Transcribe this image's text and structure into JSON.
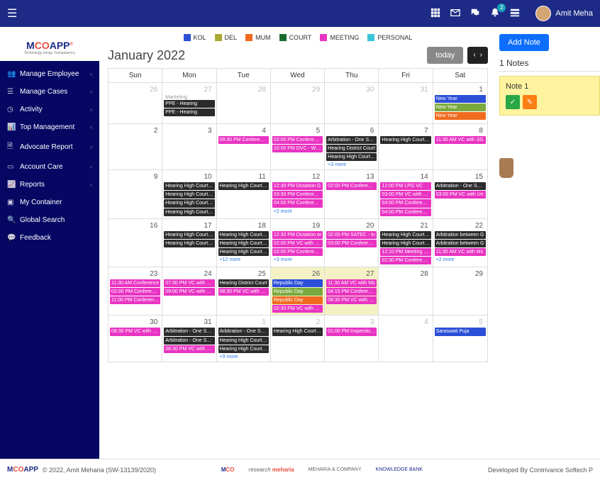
{
  "topbar": {
    "notif_count": "2",
    "user_name": "Amit Meha"
  },
  "brand": {
    "name": "MCOAPP",
    "tagline": "Technology brings Transparency"
  },
  "nav": [
    {
      "icon": "users",
      "label": "Manage Employee",
      "exp": true
    },
    {
      "icon": "list",
      "label": "Manage Cases",
      "exp": true
    },
    {
      "icon": "clock",
      "label": "Activity",
      "exp": true
    },
    {
      "icon": "chart",
      "label": "Top Management",
      "exp": true
    },
    {
      "icon": "file",
      "label": "Advocate Report",
      "exp": true
    },
    {
      "icon": "card",
      "label": "Account Care",
      "exp": true
    },
    {
      "icon": "bars",
      "label": "Reports",
      "exp": true
    },
    {
      "icon": "box",
      "label": "My Container",
      "exp": false
    },
    {
      "icon": "search",
      "label": "Global Search",
      "exp": false
    },
    {
      "icon": "chat",
      "label": "Feedback",
      "exp": false
    }
  ],
  "legend": [
    {
      "label": "KOL",
      "color": "#2c4fd8"
    },
    {
      "label": "DEL",
      "color": "#a8a833"
    },
    {
      "label": "MUM",
      "color": "#f06a1f"
    },
    {
      "label": "COURT",
      "color": "#1a6b2e"
    },
    {
      "label": "MEETING",
      "color": "#e934c3"
    },
    {
      "label": "PERSONAL",
      "color": "#3dc4d8"
    }
  ],
  "calendar": {
    "title": "January 2022",
    "today_label": "today",
    "day_names": [
      "Sun",
      "Mon",
      "Tue",
      "Wed",
      "Thu",
      "Fri",
      "Sat"
    ],
    "weeks": [
      [
        {
          "d": "26",
          "muted": true
        },
        {
          "d": "27",
          "muted": true,
          "allday": "Marketing",
          "events": [
            {
              "t": "PPE - Hearing",
              "c": "dark"
            },
            {
              "t": "PPE - Hearing",
              "c": "dark"
            }
          ]
        },
        {
          "d": "28",
          "muted": true
        },
        {
          "d": "29",
          "muted": true
        },
        {
          "d": "30",
          "muted": true
        },
        {
          "d": "31",
          "muted": true
        },
        {
          "d": "1",
          "events": [
            {
              "t": "New Year",
              "c": "blue"
            },
            {
              "t": "New Year",
              "c": "green"
            },
            {
              "t": "New Year",
              "c": "orange"
            }
          ]
        }
      ],
      [
        {
          "d": "2"
        },
        {
          "d": "3"
        },
        {
          "d": "4",
          "events": [
            {
              "t": "09:30 PM Conference",
              "c": "pink"
            }
          ]
        },
        {
          "d": "5",
          "events": [
            {
              "t": "02:00 PM Conference",
              "c": "pink"
            },
            {
              "t": "10:00 PM DVC - WBE",
              "c": "pink"
            }
          ]
        },
        {
          "d": "6",
          "events": [
            {
              "t": "Arbitration - One Sess",
              "c": "dark"
            },
            {
              "t": "Hearing District Court",
              "c": "dark"
            },
            {
              "t": "Hearing High Court/Tr",
              "c": "dark"
            }
          ],
          "more": "+3 more"
        },
        {
          "d": "7",
          "events": [
            {
              "t": "Hearing High Court/Tr",
              "c": "dark"
            }
          ]
        },
        {
          "d": "8",
          "events": [
            {
              "t": "11:30 AM VC with SG",
              "c": "pink"
            }
          ]
        }
      ],
      [
        {
          "d": "9"
        },
        {
          "d": "10",
          "events": [
            {
              "t": "Hearing High Court/Tr",
              "c": "dark"
            },
            {
              "t": "Hearing High Court/Tr",
              "c": "dark"
            },
            {
              "t": "Hearing High Court/Tr",
              "c": "dark"
            },
            {
              "t": "Hearing High Court/Tr",
              "c": "dark"
            }
          ]
        },
        {
          "d": "11",
          "events": [
            {
              "t": "Hearing High Court/Tr",
              "c": "dark"
            }
          ]
        },
        {
          "d": "12",
          "events": [
            {
              "t": "12:30 PM Dictation G",
              "c": "pink"
            },
            {
              "t": "03:30 PM Conference",
              "c": "pink"
            },
            {
              "t": "04:00 PM Conference",
              "c": "pink"
            }
          ],
          "more": "+2 more"
        },
        {
          "d": "13",
          "events": [
            {
              "t": "02:00 PM Conference",
              "c": "pink"
            }
          ]
        },
        {
          "d": "14",
          "events": [
            {
              "t": "12:00 PM LPG VC",
              "c": "pink"
            },
            {
              "t": "03:00 PM VC with Urr",
              "c": "pink"
            },
            {
              "t": "04:00 PM Conference",
              "c": "pink"
            },
            {
              "t": "04:00 PM Conference",
              "c": "pink"
            }
          ]
        },
        {
          "d": "15",
          "events": [
            {
              "t": "Arbitration - One Sess",
              "c": "dark"
            },
            {
              "t": "03:00 PM VC with Urr",
              "c": "pink"
            }
          ]
        }
      ],
      [
        {
          "d": "16"
        },
        {
          "d": "17",
          "events": [
            {
              "t": "Hearing High Court/Tr",
              "c": "dark"
            },
            {
              "t": "Hearing High Court/Tr",
              "c": "dark"
            }
          ]
        },
        {
          "d": "18",
          "events": [
            {
              "t": "Hearing High Court/Tr",
              "c": "dark"
            },
            {
              "t": "Hearing High Court/Tr",
              "c": "dark"
            },
            {
              "t": "Hearing High Court/Tr",
              "c": "dark"
            }
          ],
          "more": "+12 more"
        },
        {
          "d": "19",
          "events": [
            {
              "t": "12:30 PM Dictation or",
              "c": "pink"
            },
            {
              "t": "02:00 PM VC with Vin",
              "c": "pink"
            },
            {
              "t": "02:00 PM Conference",
              "c": "pink"
            }
          ],
          "more": "+3 more"
        },
        {
          "d": "20",
          "events": [
            {
              "t": "02:00 PM SATEC - In",
              "c": "pink"
            },
            {
              "t": "03:00 PM Conference",
              "c": "pink"
            }
          ]
        },
        {
          "d": "21",
          "events": [
            {
              "t": "Hearing High Court/Tr",
              "c": "dark"
            },
            {
              "t": "Hearing High Court/Tr",
              "c": "dark"
            },
            {
              "t": "12:10 PM Meeting Sh",
              "c": "pink"
            },
            {
              "t": "02:30 PM Conference",
              "c": "pink"
            }
          ]
        },
        {
          "d": "22",
          "events": [
            {
              "t": "Arbitration between G",
              "c": "dark"
            },
            {
              "t": "Arbitration between G",
              "c": "dark"
            },
            {
              "t": "11:30 AM VC with Ms",
              "c": "pink"
            }
          ],
          "more": "+2 more"
        }
      ],
      [
        {
          "d": "23",
          "events": [
            {
              "t": "11:30 AM Conference",
              "c": "pink"
            },
            {
              "t": "02:00 PM Conference",
              "c": "pink"
            },
            {
              "t": "11:00 PM Conference",
              "c": "pink"
            }
          ]
        },
        {
          "d": "24",
          "events": [
            {
              "t": "07:30 PM VC with Mr.",
              "c": "pink"
            },
            {
              "t": "09:00 PM VC with Mr.",
              "c": "pink"
            }
          ]
        },
        {
          "d": "25",
          "events": [
            {
              "t": "Hearing District Court",
              "c": "dark"
            },
            {
              "t": "08:30 PM VC with Mr.",
              "c": "pink"
            }
          ]
        },
        {
          "d": "26",
          "hl": "yellow",
          "events": [
            {
              "t": "Republic Day",
              "c": "blue"
            },
            {
              "t": "Republic Day",
              "c": "green"
            },
            {
              "t": "Republic Day",
              "c": "orange"
            },
            {
              "t": "02:30 PM VC with Mr.",
              "c": "pink"
            }
          ]
        },
        {
          "d": "27",
          "hl": "yellow",
          "events": [
            {
              "t": "11:30 AM VC with Ms",
              "c": "pink"
            },
            {
              "t": "04:15 PM Conference",
              "c": "pink"
            },
            {
              "t": "08:30 PM VC with Mr.",
              "c": "pink"
            }
          ]
        },
        {
          "d": "28"
        },
        {
          "d": "29"
        }
      ],
      [
        {
          "d": "30",
          "events": [
            {
              "t": "08:30 PM VC with Mr.",
              "c": "pink"
            }
          ]
        },
        {
          "d": "31",
          "events": [
            {
              "t": "Arbitration - One Sess",
              "c": "dark"
            },
            {
              "t": "Arbitration - One Sess",
              "c": "dark"
            },
            {
              "t": "08:30 PM VC with Mr.",
              "c": "pink"
            }
          ]
        },
        {
          "d": "1",
          "muted": true,
          "events": [
            {
              "t": "Arbitration - One Sess",
              "c": "dark"
            },
            {
              "t": "Hearing High Court/Tr",
              "c": "dark"
            },
            {
              "t": "Hearing High Court/Tr",
              "c": "dark"
            }
          ],
          "more": "+9 more"
        },
        {
          "d": "2",
          "muted": true,
          "events": [
            {
              "t": "Hearing High Court/Tr",
              "c": "dark"
            }
          ]
        },
        {
          "d": "3",
          "muted": true,
          "events": [
            {
              "t": "01:00 PM Inspection a",
              "c": "pink"
            }
          ]
        },
        {
          "d": "4",
          "muted": true
        },
        {
          "d": "5",
          "muted": true,
          "events": [
            {
              "t": "Saraswati Puja",
              "c": "blue"
            }
          ]
        }
      ]
    ]
  },
  "notes": {
    "add_label": "Add Note",
    "count_label": "1 Notes",
    "items": [
      {
        "title": "Note 1"
      }
    ]
  },
  "footer": {
    "copyright": "© 2022, Amit Meharia (SW-13139/2020)",
    "mid1": "MCO",
    "mid2": "research",
    "mid3": "meharia",
    "mid4": "MEHARIA & COMPANY",
    "mid5": "KNOWLEDGE BANK",
    "dev": "Developed By Contrivance Softech P"
  }
}
